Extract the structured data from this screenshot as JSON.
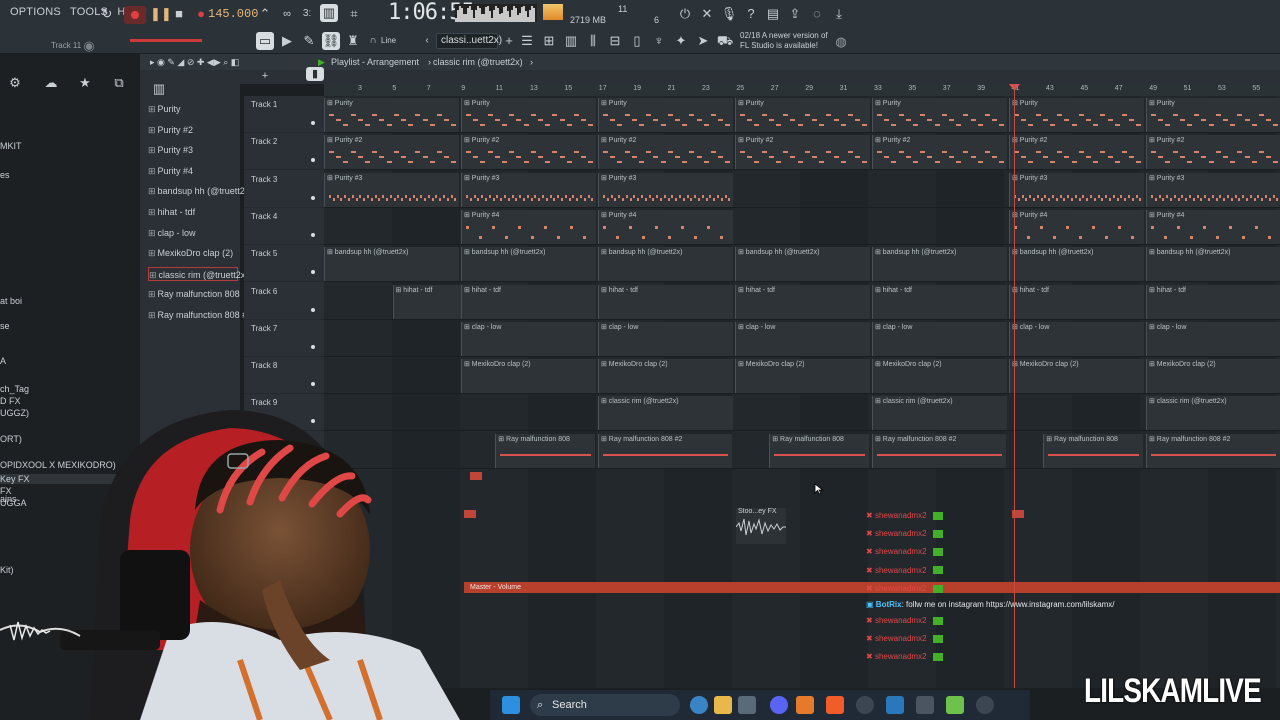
{
  "toolbar": {
    "menu": [
      "OPTIONS",
      "TOOLS",
      "HELP"
    ],
    "tempo": "145.000",
    "clock": "1:06:55",
    "cpu_mem": "2719 MB",
    "cpu_num_top": "11",
    "cpu_num_bottom": "6",
    "pattern_name": "classi..uett2x)",
    "snap": "Line",
    "track_label": "Track 11",
    "update_hint": "02/18  A newer version of FL Studio is available!"
  },
  "browser": {
    "items": [
      "MKIT",
      "es",
      "at boi",
      "se",
      "A",
      "ch_Tag",
      "D FX",
      "UGGZ)",
      "ORT)",
      "OPIDXOOL X MEXIKODRO)",
      "Key FX",
      "ains",
      "FX",
      "UGGA",
      "Kit)"
    ]
  },
  "picker": {
    "items": [
      "Purity",
      "Purity #2",
      "Purity #3",
      "Purity #4",
      "bandsup hh (@truett2x)",
      "hihat - tdf",
      "clap - low",
      "MexikoDro clap (2)",
      "classic rim (@truett2x)",
      "Ray malfunction 808",
      "Ray malfunction 808 #2"
    ],
    "selected_index": 8
  },
  "playlist": {
    "title": "Playlist - Arrangement",
    "pattern": "classic rim (@truett2x)",
    "ruler": [
      "3",
      "5",
      "7",
      "9",
      "11",
      "13",
      "15",
      "17",
      "19",
      "21",
      "23",
      "25",
      "27",
      "29",
      "31",
      "33",
      "35",
      "37",
      "39",
      "41",
      "43",
      "45",
      "47",
      "49",
      "51",
      "53",
      "55"
    ],
    "tracks": [
      "Track 1",
      "Track 2",
      "Track 3",
      "Track 4",
      "Track 5",
      "Track 6",
      "Track 7",
      "Track 8",
      "Track 9"
    ],
    "rows": [
      {
        "pattern": "Purity",
        "starts": [
          0,
          1,
          2,
          3,
          4,
          5,
          6
        ],
        "notes": "dense"
      },
      {
        "pattern": "Purity #2",
        "starts": [
          0,
          1,
          2,
          3,
          4,
          5,
          6
        ],
        "notes": "dense"
      },
      {
        "pattern": "Purity #3",
        "starts": [
          0,
          1,
          2,
          5,
          6
        ],
        "notes": "dots"
      },
      {
        "pattern": "Purity #4",
        "starts": [
          1,
          2,
          5,
          6
        ],
        "notes": "sparse"
      },
      {
        "pattern": "bandsup hh (@truett2x)",
        "starts": [
          0,
          1,
          2,
          3,
          4,
          5,
          6
        ],
        "notes": "none"
      },
      {
        "pattern": "hihat - tdf",
        "starts": [
          0.5,
          1,
          2,
          3,
          4,
          5,
          6
        ],
        "notes": "none"
      },
      {
        "pattern": "clap - low",
        "starts": [
          1,
          2,
          3,
          4,
          5,
          6
        ],
        "notes": "none"
      },
      {
        "pattern": "MexikoDro clap (2)",
        "starts": [
          1,
          2,
          3,
          4,
          5,
          6
        ],
        "notes": "none"
      },
      {
        "pattern": "classic rim (@truett2x)",
        "starts": [
          2,
          4,
          6
        ],
        "notes": "none"
      },
      {
        "pattern": "Ray malfunction 808",
        "starts": [
          1.25,
          2,
          3.25,
          4,
          5.25,
          6
        ],
        "names_alt": [
          "Ray malfunction 808",
          "Ray malfunction 808 #2"
        ],
        "notes": "line"
      }
    ],
    "audio_clip": "Stoo...ey FX",
    "automation": "Master - Volume"
  },
  "chat": {
    "users": [
      "shewanadmx2",
      "shewanadmx2",
      "shewanadmx2",
      "shewanadmx2",
      "shewanadmx2"
    ],
    "bot_name": "BotRix",
    "bot_message": ": follw me on instagram https://www.instagram.com/lilskamx/",
    "users_lower": [
      "shewanadmx2",
      "shewanadmx2",
      "shewanadmx2"
    ]
  },
  "taskbar": {
    "search": "Search"
  },
  "watermark": "LILSKAMLIVE"
}
